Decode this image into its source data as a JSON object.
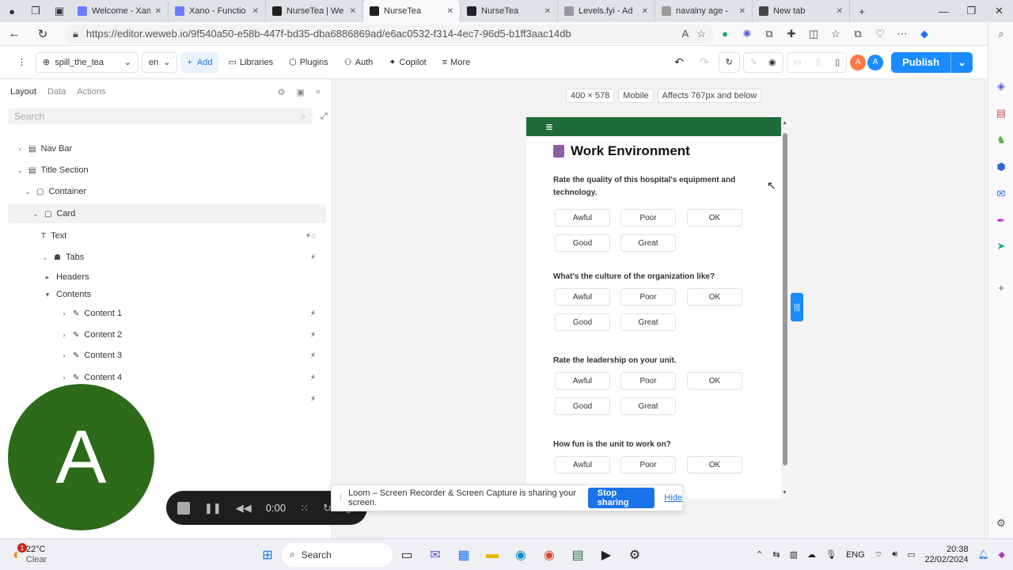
{
  "browser": {
    "tabs": [
      {
        "label": "Welcome - Xan",
        "fav": "#6b7cff"
      },
      {
        "label": "Xano - Functio",
        "fav": "#6b7cff"
      },
      {
        "label": "NurseTea | We",
        "fav": "#222"
      },
      {
        "label": "NurseTea",
        "fav": "#222"
      },
      {
        "label": "NurseTea",
        "fav": "#222"
      },
      {
        "label": "Levels.fyi - Ad",
        "fav": "#999"
      },
      {
        "label": "navalny age -",
        "fav": "#999"
      },
      {
        "label": "New tab",
        "fav": "#444"
      }
    ],
    "url": "https://editor.weweb.io/9f540a50-e58b-447f-bd35-dba6886869ad/e6ac0532-f314-4ec7-96d5-b1ff3aac14db"
  },
  "toolbar": {
    "project": "spill_the_tea",
    "lang": "en",
    "add": "Add",
    "libraries": "Libraries",
    "plugins": "Plugins",
    "auth": "Auth",
    "copilot": "Copilot",
    "more": "More",
    "publish": "Publish",
    "avatar1": "A",
    "avatar2": "A"
  },
  "sidebar": {
    "tabs": [
      "Layout",
      "Data",
      "Actions"
    ],
    "search_placeholder": "Search",
    "tree": [
      "Nav Bar",
      "Title Section",
      "Container",
      "Card",
      "Text",
      "Tabs",
      "Headers",
      "Contents",
      "Content 1",
      "Content 2",
      "Content 3",
      "Content 4"
    ]
  },
  "canvas": {
    "size": "400 × 578",
    "device": "Mobile",
    "affects": "Affects 767px and below"
  },
  "page": {
    "title": "Work Environment",
    "questions": [
      {
        "text": "Rate the quality of this hospital's equipment and technology.",
        "options": [
          "Awful",
          "Poor",
          "OK",
          "Good",
          "Great"
        ]
      },
      {
        "text": "What's the culture of the organization like?",
        "options": [
          "Awful",
          "Poor",
          "OK",
          "Good",
          "Great"
        ]
      },
      {
        "text": "Rate the leadership on your unit.",
        "options": [
          "Awful",
          "Poor",
          "OK",
          "Good",
          "Great"
        ]
      },
      {
        "text": "How fun is the unit to work on?",
        "options": [
          "Awful",
          "Poor",
          "OK"
        ]
      }
    ]
  },
  "loom": {
    "message": "Loom – Screen Recorder & Screen Capture is sharing your screen.",
    "stop": "Stop sharing",
    "hide": "Hide"
  },
  "recorder": {
    "time": "0:00",
    "avatar": "A"
  },
  "taskbar": {
    "temp": "22°C",
    "weather": "Clear",
    "weather_badge": "1",
    "search": "Search",
    "lang": "ENG",
    "time": "20:38",
    "date": "22/02/2024"
  }
}
